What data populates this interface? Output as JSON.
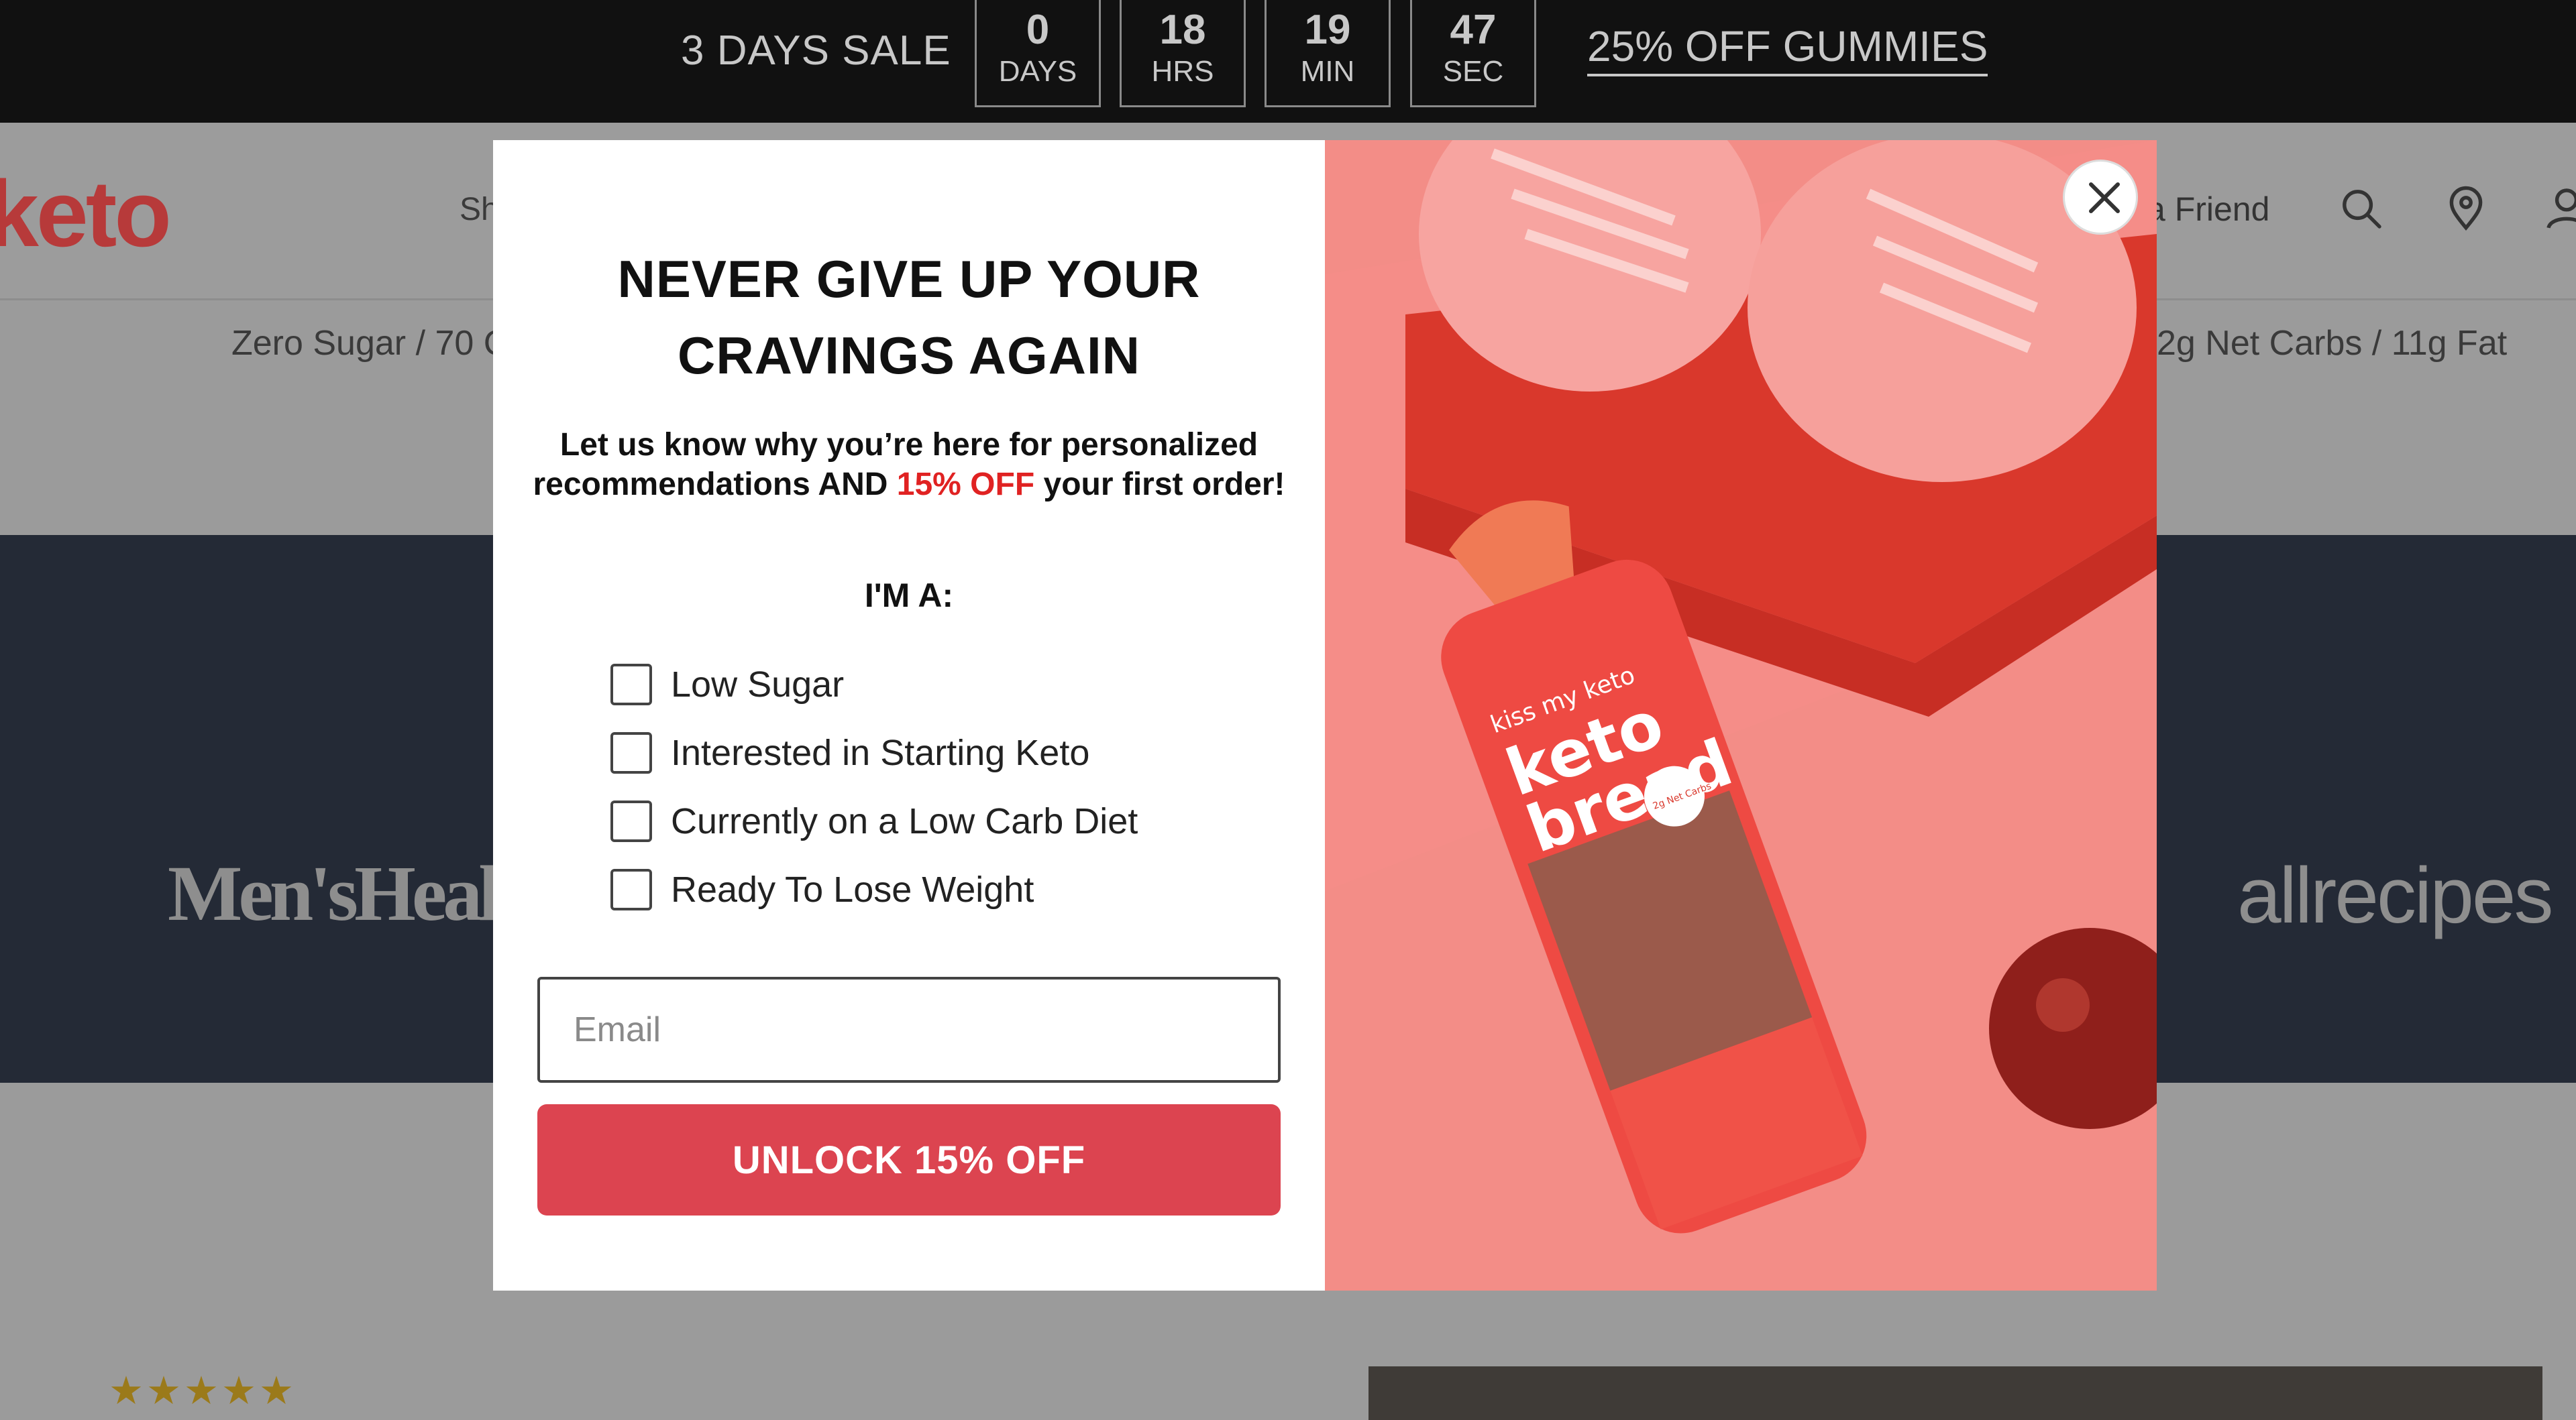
{
  "announcement": {
    "sale_label": "3 DAYS SALE",
    "countdown": [
      {
        "value": "0",
        "unit": "DAYS"
      },
      {
        "value": "18",
        "unit": "HRS"
      },
      {
        "value": "19",
        "unit": "MIN"
      },
      {
        "value": "47",
        "unit": "SEC"
      }
    ],
    "promo_link": "25% OFF GUMMIES"
  },
  "header": {
    "logo_text": "keto",
    "nav_partial_left": "Sh",
    "nav_partial_right": "a Friend",
    "icons": [
      "search-icon",
      "location-pin-icon",
      "account-icon"
    ]
  },
  "subheader": {
    "left_text": "Zero Sugar / 70 C",
    "right_text": "2g Net Carbs / 11g Fat"
  },
  "press": {
    "left_logo": "Men'sHealth",
    "right_logo": "allrecipes"
  },
  "reviews": {
    "stars": "★★★★★"
  },
  "modal": {
    "heading_line1": "NEVER GIVE UP YOUR",
    "heading_line2": "CRAVINGS AGAIN",
    "desc_before": "Let us know why you’re here for personalized recommendations AND ",
    "desc_highlight": "15% OFF",
    "desc_after": " your first order!",
    "im_a": "I'M A:",
    "options": [
      {
        "label": "Low Sugar",
        "checked": false
      },
      {
        "label": "Interested in Starting Keto",
        "checked": false
      },
      {
        "label": "Currently on a Low Carb Diet",
        "checked": false
      },
      {
        "label": "Ready To Lose Weight",
        "checked": false
      }
    ],
    "email_placeholder": "Email",
    "email_value": "",
    "submit_label": "UNLOCK 15% OFF",
    "close_icon": "close-icon",
    "image": {
      "bag_brand": "kiss my keto",
      "bag_title_1": "keto",
      "bag_title_2": "bread",
      "bag_badge": "2g Net Carbs"
    },
    "colors": {
      "accent": "#dc4450",
      "highlight": "#e02222",
      "image_bg": "#f28a85"
    }
  }
}
